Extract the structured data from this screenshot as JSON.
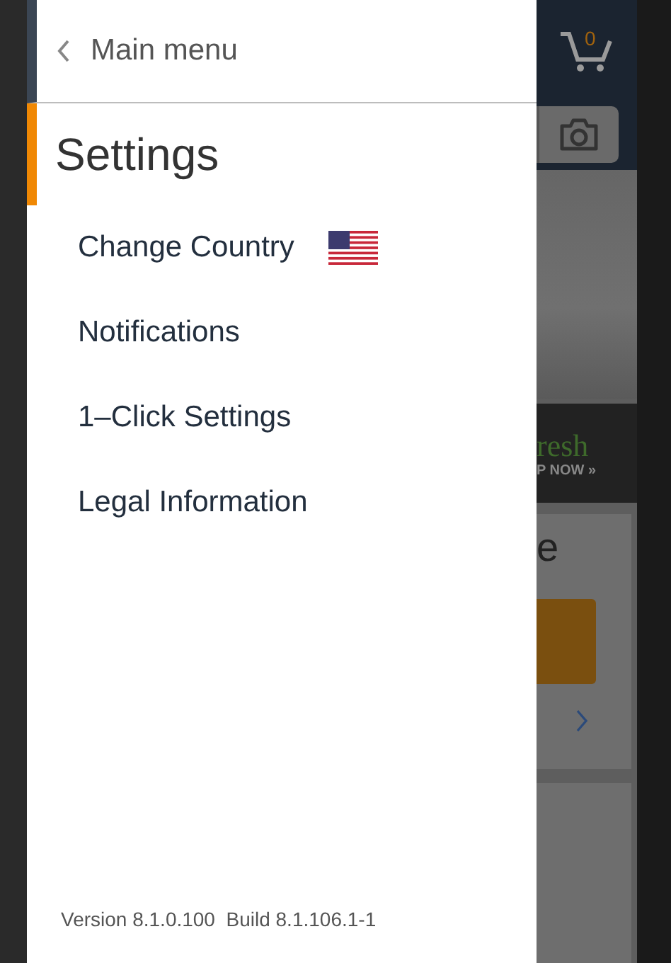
{
  "drawer": {
    "back_label": "Main menu",
    "title": "Settings",
    "items": [
      {
        "label": "Change Country",
        "kind": "flag"
      },
      {
        "label": "Notifications",
        "kind": "plain"
      },
      {
        "label": "1–Click Settings",
        "kind": "plain"
      },
      {
        "label": "Legal Information",
        "kind": "plain"
      }
    ],
    "version": "Version 8.1.0.100  Build 8.1.106.1-1"
  },
  "background_app": {
    "cart_count": "0",
    "promo_text": "resh",
    "promo_link": "P NOW »",
    "card_text": "e"
  }
}
